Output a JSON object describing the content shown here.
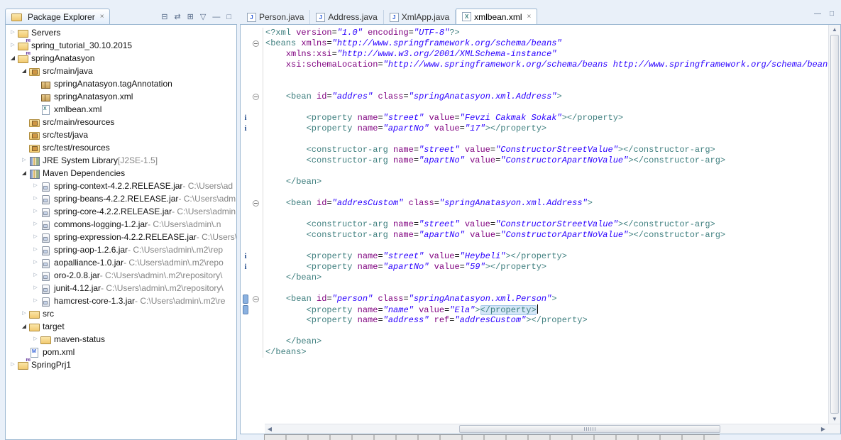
{
  "icons": {
    "close": "×",
    "minimize": "—",
    "maximize": "□",
    "scroll_up": "▲",
    "scroll_down": "▼",
    "scroll_left": "◀",
    "scroll_right": "▶",
    "expanded_arrow": "◢",
    "collapsed_arrow": "▷"
  },
  "colors": {
    "xml_tag": "#3f7f7f",
    "xml_attribute": "#7f007f",
    "xml_attribute_value": "#2a00ff",
    "occurrence_marker": "#8ab1e0",
    "matching_tag_highlight": "#d4e7f8",
    "chrome_background": "#e9f0f9"
  },
  "package_explorer": {
    "tab_title": "Package Explorer",
    "toolbar": [
      {
        "name": "collapse-all-icon",
        "glyph": "⊟"
      },
      {
        "name": "link-with-editor-icon",
        "glyph": "⇄"
      },
      {
        "name": "focus-icon",
        "glyph": "⊞"
      },
      {
        "name": "view-menu-icon",
        "glyph": "▽"
      },
      {
        "name": "minimize-icon",
        "glyph": "—"
      },
      {
        "name": "maximize-icon",
        "glyph": "□"
      }
    ],
    "tree": [
      {
        "label": "Servers",
        "sub": "",
        "indent": 0,
        "arrow": "closed",
        "icon": "servers-folder"
      },
      {
        "label": "spring_tutorial_30.10.2015",
        "sub": "",
        "indent": 0,
        "arrow": "closed",
        "icon": "maven-project"
      },
      {
        "label": "springAnatasyon",
        "sub": "",
        "indent": 0,
        "arrow": "open",
        "icon": "maven-project"
      },
      {
        "label": "src/main/java",
        "sub": "",
        "indent": 1,
        "arrow": "open",
        "icon": "source-folder"
      },
      {
        "label": "springAnatasyon.tagAnnotation",
        "sub": "",
        "indent": 2,
        "arrow": "none",
        "icon": "package"
      },
      {
        "label": "springAnatasyon.xml",
        "sub": "",
        "indent": 2,
        "arrow": "none",
        "icon": "package"
      },
      {
        "label": "xmlbean.xml",
        "sub": "",
        "indent": 2,
        "arrow": "none",
        "icon": "xml-file"
      },
      {
        "label": "src/main/resources",
        "sub": "",
        "indent": 1,
        "arrow": "none",
        "icon": "source-folder"
      },
      {
        "label": "src/test/java",
        "sub": "",
        "indent": 1,
        "arrow": "none",
        "icon": "source-folder"
      },
      {
        "label": "src/test/resources",
        "sub": "",
        "indent": 1,
        "arrow": "none",
        "icon": "source-folder"
      },
      {
        "label": "JRE System Library",
        "sub": " [J2SE-1.5]",
        "indent": 1,
        "arrow": "closed",
        "icon": "library"
      },
      {
        "label": "Maven Dependencies",
        "sub": "",
        "indent": 1,
        "arrow": "open",
        "icon": "library"
      },
      {
        "label": "spring-context-4.2.2.RELEASE.jar",
        "sub": " - C:\\Users\\ad",
        "indent": 2,
        "arrow": "closed",
        "icon": "jar"
      },
      {
        "label": "spring-beans-4.2.2.RELEASE.jar",
        "sub": " - C:\\Users\\adm",
        "indent": 2,
        "arrow": "closed",
        "icon": "jar"
      },
      {
        "label": "spring-core-4.2.2.RELEASE.jar",
        "sub": " - C:\\Users\\admin",
        "indent": 2,
        "arrow": "closed",
        "icon": "jar"
      },
      {
        "label": "commons-logging-1.2.jar",
        "sub": " - C:\\Users\\admin\\.n",
        "indent": 2,
        "arrow": "closed",
        "icon": "jar"
      },
      {
        "label": "spring-expression-4.2.2.RELEASE.jar",
        "sub": " - C:\\Users\\",
        "indent": 2,
        "arrow": "closed",
        "icon": "jar"
      },
      {
        "label": "spring-aop-1.2.6.jar",
        "sub": " - C:\\Users\\admin\\.m2\\rep",
        "indent": 2,
        "arrow": "closed",
        "icon": "jar"
      },
      {
        "label": "aopalliance-1.0.jar",
        "sub": " - C:\\Users\\admin\\.m2\\repo",
        "indent": 2,
        "arrow": "closed",
        "icon": "jar"
      },
      {
        "label": "oro-2.0.8.jar",
        "sub": " - C:\\Users\\admin\\.m2\\repository\\",
        "indent": 2,
        "arrow": "closed",
        "icon": "jar"
      },
      {
        "label": "junit-4.12.jar",
        "sub": " - C:\\Users\\admin\\.m2\\repository\\",
        "indent": 2,
        "arrow": "closed",
        "icon": "jar"
      },
      {
        "label": "hamcrest-core-1.3.jar",
        "sub": " - C:\\Users\\admin\\.m2\\re",
        "indent": 2,
        "arrow": "closed",
        "icon": "jar"
      },
      {
        "label": "src",
        "sub": "",
        "indent": 1,
        "arrow": "closed",
        "icon": "folder"
      },
      {
        "label": "target",
        "sub": "",
        "indent": 1,
        "arrow": "open",
        "icon": "folder"
      },
      {
        "label": "maven-status",
        "sub": "",
        "indent": 2,
        "arrow": "closed",
        "icon": "folder"
      },
      {
        "label": "pom.xml",
        "sub": "",
        "indent": 1,
        "arrow": "none",
        "icon": "pom-file"
      },
      {
        "label": "SpringPrj1",
        "sub": "",
        "indent": 0,
        "arrow": "closed",
        "icon": "maven-project"
      }
    ]
  },
  "editor": {
    "tabs": [
      {
        "label": "Person.java",
        "icon": "java-file",
        "active": false
      },
      {
        "label": "Address.java",
        "icon": "java-file",
        "active": false
      },
      {
        "label": "XmlApp.java",
        "icon": "java-file",
        "active": false
      },
      {
        "label": "xmlbean.xml",
        "icon": "xml-file",
        "active": true
      }
    ],
    "code": {
      "lines": [
        {
          "t": [
            [
              "g",
              "<?xml "
            ],
            [
              "a",
              "version"
            ],
            [
              "p",
              "="
            ],
            [
              "v",
              "\"1.0\""
            ],
            [
              "p",
              " "
            ],
            [
              "a",
              "encoding"
            ],
            [
              "p",
              "="
            ],
            [
              "v",
              "\"UTF-8\""
            ],
            [
              "g",
              "?>"
            ]
          ]
        },
        {
          "fold": true,
          "t": [
            [
              "g",
              "<beans "
            ],
            [
              "a",
              "xmlns"
            ],
            [
              "p",
              "="
            ],
            [
              "v",
              "\"http://www.springframework.org/schema/beans\""
            ]
          ]
        },
        {
          "t": [
            [
              "p",
              "    "
            ],
            [
              "a",
              "xmlns:xsi"
            ],
            [
              "p",
              "="
            ],
            [
              "v",
              "\"http://www.w3.org/2001/XMLSchema-instance\""
            ]
          ]
        },
        {
          "t": [
            [
              "p",
              "    "
            ],
            [
              "a",
              "xsi:schemaLocation"
            ],
            [
              "p",
              "="
            ],
            [
              "v",
              "\"http://www.springframework.org/schema/beans http://www.springframework.org/schema/beans/"
            ]
          ]
        },
        {
          "t": []
        },
        {
          "t": []
        },
        {
          "fold": true,
          "t": [
            [
              "p",
              "    "
            ],
            [
              "g",
              "<bean "
            ],
            [
              "a",
              "id"
            ],
            [
              "p",
              "="
            ],
            [
              "v",
              "\"addres\""
            ],
            [
              "p",
              " "
            ],
            [
              "a",
              "class"
            ],
            [
              "p",
              "="
            ],
            [
              "v",
              "\"springAnatasyon.xml.Address\""
            ],
            [
              "g",
              ">"
            ]
          ]
        },
        {
          "t": []
        },
        {
          "info": true,
          "t": [
            [
              "p",
              "        "
            ],
            [
              "g",
              "<property "
            ],
            [
              "a",
              "name"
            ],
            [
              "p",
              "="
            ],
            [
              "v",
              "\"street\""
            ],
            [
              "p",
              " "
            ],
            [
              "a",
              "value"
            ],
            [
              "p",
              "="
            ],
            [
              "v",
              "\"Fevzi Cakmak Sokak\""
            ],
            [
              "g",
              "></property>"
            ]
          ]
        },
        {
          "info": true,
          "t": [
            [
              "p",
              "        "
            ],
            [
              "g",
              "<property "
            ],
            [
              "a",
              "name"
            ],
            [
              "p",
              "="
            ],
            [
              "v",
              "\"apartNo\""
            ],
            [
              "p",
              " "
            ],
            [
              "a",
              "value"
            ],
            [
              "p",
              "="
            ],
            [
              "v",
              "\"17\""
            ],
            [
              "g",
              "></property>"
            ]
          ]
        },
        {
          "t": []
        },
        {
          "t": [
            [
              "p",
              "        "
            ],
            [
              "g",
              "<constructor-arg "
            ],
            [
              "a",
              "name"
            ],
            [
              "p",
              "="
            ],
            [
              "v",
              "\"street\""
            ],
            [
              "p",
              " "
            ],
            [
              "a",
              "value"
            ],
            [
              "p",
              "="
            ],
            [
              "v",
              "\"ConstructorStreetValue\""
            ],
            [
              "g",
              "></constructor-arg>"
            ]
          ]
        },
        {
          "t": [
            [
              "p",
              "        "
            ],
            [
              "g",
              "<constructor-arg "
            ],
            [
              "a",
              "name"
            ],
            [
              "p",
              "="
            ],
            [
              "v",
              "\"apartNo\""
            ],
            [
              "p",
              " "
            ],
            [
              "a",
              "value"
            ],
            [
              "p",
              "="
            ],
            [
              "v",
              "\"ConstructorApartNoValue\""
            ],
            [
              "g",
              "></constructor-arg>"
            ]
          ]
        },
        {
          "t": []
        },
        {
          "t": [
            [
              "p",
              "    "
            ],
            [
              "g",
              "</bean>"
            ]
          ]
        },
        {
          "t": []
        },
        {
          "fold": true,
          "t": [
            [
              "p",
              "    "
            ],
            [
              "g",
              "<bean "
            ],
            [
              "a",
              "id"
            ],
            [
              "p",
              "="
            ],
            [
              "v",
              "\"addresCustom\""
            ],
            [
              "p",
              " "
            ],
            [
              "a",
              "class"
            ],
            [
              "p",
              "="
            ],
            [
              "v",
              "\"springAnatasyon.xml.Address\""
            ],
            [
              "g",
              ">"
            ]
          ]
        },
        {
          "t": []
        },
        {
          "t": [
            [
              "p",
              "        "
            ],
            [
              "g",
              "<constructor-arg "
            ],
            [
              "a",
              "name"
            ],
            [
              "p",
              "="
            ],
            [
              "v",
              "\"street\""
            ],
            [
              "p",
              " "
            ],
            [
              "a",
              "value"
            ],
            [
              "p",
              "="
            ],
            [
              "v",
              "\"ConstructorStreetValue\""
            ],
            [
              "g",
              "></constructor-arg>"
            ]
          ]
        },
        {
          "t": [
            [
              "p",
              "        "
            ],
            [
              "g",
              "<constructor-arg "
            ],
            [
              "a",
              "name"
            ],
            [
              "p",
              "="
            ],
            [
              "v",
              "\"apartNo\""
            ],
            [
              "p",
              " "
            ],
            [
              "a",
              "value"
            ],
            [
              "p",
              "="
            ],
            [
              "v",
              "\"ConstructorApartNoValue\""
            ],
            [
              "g",
              "></constructor-arg>"
            ]
          ]
        },
        {
          "t": []
        },
        {
          "info": true,
          "t": [
            [
              "p",
              "        "
            ],
            [
              "g",
              "<property "
            ],
            [
              "a",
              "name"
            ],
            [
              "p",
              "="
            ],
            [
              "v",
              "\"street\""
            ],
            [
              "p",
              " "
            ],
            [
              "a",
              "value"
            ],
            [
              "p",
              "="
            ],
            [
              "v",
              "\"Heybeli\""
            ],
            [
              "g",
              "></property>"
            ]
          ]
        },
        {
          "info": true,
          "t": [
            [
              "p",
              "        "
            ],
            [
              "g",
              "<property "
            ],
            [
              "a",
              "name"
            ],
            [
              "p",
              "="
            ],
            [
              "v",
              "\"apartNo\""
            ],
            [
              "p",
              " "
            ],
            [
              "a",
              "value"
            ],
            [
              "p",
              "="
            ],
            [
              "v",
              "\"59\""
            ],
            [
              "g",
              "></property>"
            ]
          ]
        },
        {
          "t": [
            [
              "p",
              "    "
            ],
            [
              "g",
              "</bean>"
            ]
          ]
        },
        {
          "t": []
        },
        {
          "fold": true,
          "mark": true,
          "t": [
            [
              "p",
              "    "
            ],
            [
              "g",
              "<bean "
            ],
            [
              "a",
              "id"
            ],
            [
              "p",
              "="
            ],
            [
              "v",
              "\"person\""
            ],
            [
              "p",
              " "
            ],
            [
              "a",
              "class"
            ],
            [
              "p",
              "="
            ],
            [
              "v",
              "\"springAnatasyon.xml.Person\""
            ],
            [
              "g",
              ">"
            ]
          ]
        },
        {
          "mark": true,
          "cursor": true,
          "t": [
            [
              "p",
              "        "
            ],
            [
              "g",
              "<property "
            ],
            [
              "a",
              "name"
            ],
            [
              "p",
              "="
            ],
            [
              "v",
              "\"name\""
            ],
            [
              "p",
              " "
            ],
            [
              "a",
              "value"
            ],
            [
              "p",
              "="
            ],
            [
              "v",
              "\"Ela\""
            ],
            [
              "g",
              ">"
            ],
            [
              "gh",
              "</property>"
            ]
          ]
        },
        {
          "t": [
            [
              "p",
              "        "
            ],
            [
              "g",
              "<property "
            ],
            [
              "a",
              "name"
            ],
            [
              "p",
              "="
            ],
            [
              "v",
              "\"address\""
            ],
            [
              "p",
              " "
            ],
            [
              "a",
              "ref"
            ],
            [
              "p",
              "="
            ],
            [
              "v",
              "\"addresCustom\""
            ],
            [
              "g",
              "></property>"
            ]
          ]
        },
        {
          "t": []
        },
        {
          "t": [
            [
              "p",
              "    "
            ],
            [
              "g",
              "</bean>"
            ]
          ]
        },
        {
          "t": [
            [
              "g",
              "</beans>"
            ]
          ]
        }
      ]
    }
  }
}
